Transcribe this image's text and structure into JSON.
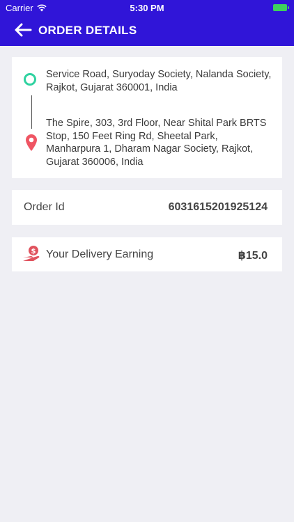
{
  "status_bar": {
    "carrier": "Carrier",
    "time": "5:30 PM"
  },
  "header": {
    "title": "ORDER DETAILS",
    "back_icon": "arrow-left-icon",
    "background": "#3015d8"
  },
  "addresses": {
    "pickup": "Service Road, Suryoday Society, Nalanda Society, Rajkot, Gujarat 360001, India",
    "drop": "The Spire, 303, 3rd Floor, Near Shital Park BRTS Stop, 150 Feet Ring Rd, Sheetal Park, Manharpura 1, Dharam Nagar Society, Rajkot, Gujarat 360006, India",
    "pickup_color": "#2fd2a0",
    "drop_color": "#ef5563"
  },
  "order": {
    "label": "Order Id",
    "value": "6031615201925124"
  },
  "earning": {
    "label": "Your Delivery Earning",
    "value": "฿15.0",
    "icon": "hand-money-icon"
  }
}
